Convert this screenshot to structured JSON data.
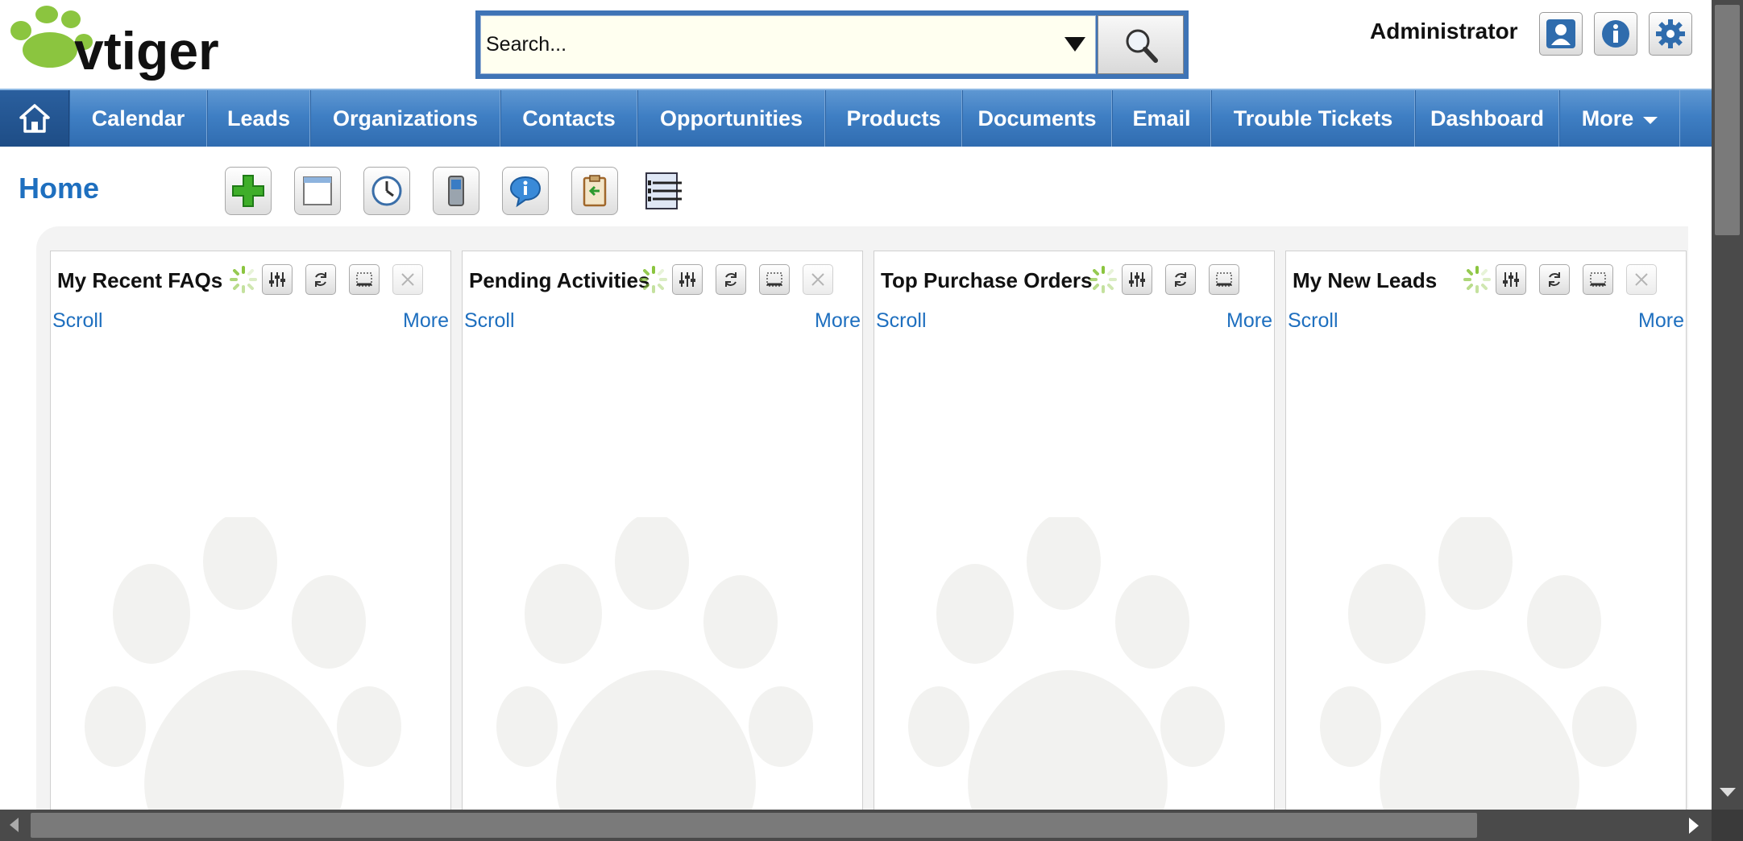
{
  "logo": {
    "text": "vtiger"
  },
  "search": {
    "placeholder": "Search...",
    "value": "Search..."
  },
  "user": {
    "name": "Administrator"
  },
  "header_icons": [
    "user-preferences-icon",
    "info-icon",
    "settings-gear-icon"
  ],
  "nav": {
    "home_icon": "home-icon",
    "items": [
      {
        "label": "Calendar"
      },
      {
        "label": "Leads"
      },
      {
        "label": "Organizations"
      },
      {
        "label": "Contacts"
      },
      {
        "label": "Opportunities"
      },
      {
        "label": "Products"
      },
      {
        "label": "Documents"
      },
      {
        "label": "Email"
      },
      {
        "label": "Trouble Tickets"
      },
      {
        "label": "Dashboard"
      },
      {
        "label": "More"
      }
    ]
  },
  "page": {
    "title": "Home"
  },
  "toolbar_icons": [
    "add-widget-icon",
    "layout-icon",
    "clock-icon",
    "mobile-icon",
    "info-bubble-icon",
    "clipboard-import-icon",
    "list-menu-icon"
  ],
  "widgets": [
    {
      "title": "My Recent FAQs",
      "scroll_label": "Scroll",
      "more_label": "More"
    },
    {
      "title": "Pending Activities",
      "scroll_label": "Scroll",
      "more_label": "More"
    },
    {
      "title": "Top Purchase Orders",
      "scroll_label": "Scroll",
      "more_label": "More"
    },
    {
      "title": "My New Leads",
      "scroll_label": "Scroll",
      "more_label": "More"
    }
  ],
  "colors": {
    "nav_blue": "#3f7fc4",
    "link_blue": "#1e6fbf",
    "logo_green": "#8bc53f",
    "search_bg": "#fffff0"
  }
}
